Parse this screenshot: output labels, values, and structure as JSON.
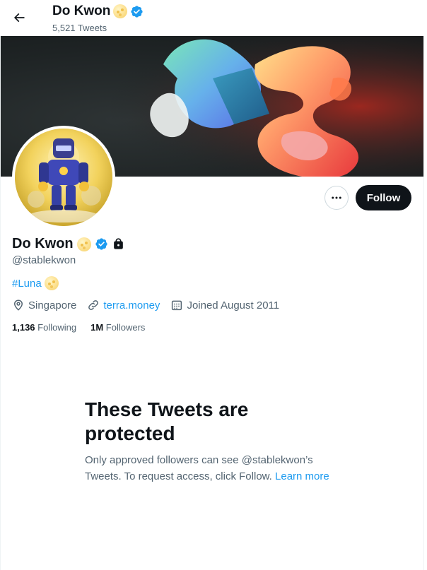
{
  "header": {
    "name": "Do Kwon",
    "tweet_count": "5,521 Tweets"
  },
  "profile": {
    "name": "Do Kwon",
    "handle": "@stablekwon",
    "bio_hashtag": "#Luna",
    "location": "Singapore",
    "website": "terra.money",
    "joined": "Joined August 2011",
    "following_count": "1,136",
    "following_label": "Following",
    "followers_count": "1M",
    "followers_label": "Followers"
  },
  "actions": {
    "follow_label": "Follow"
  },
  "protected": {
    "title": "These Tweets are protected",
    "text": "Only approved followers can see @stablekwon’s Tweets. To request access, click Follow.",
    "link": "Learn more"
  },
  "icons": {
    "back": "arrow-left-icon",
    "more": "more-dots-icon",
    "verified": "verified-badge-icon",
    "lock": "lock-icon",
    "location": "location-pin-icon",
    "link": "link-icon",
    "calendar": "calendar-icon",
    "emoji": "moon-emoji-icon"
  },
  "colors": {
    "accent": "#1d9bf0",
    "text": "#0f1419",
    "muted": "#536471",
    "follow_bg": "#0f1419"
  }
}
